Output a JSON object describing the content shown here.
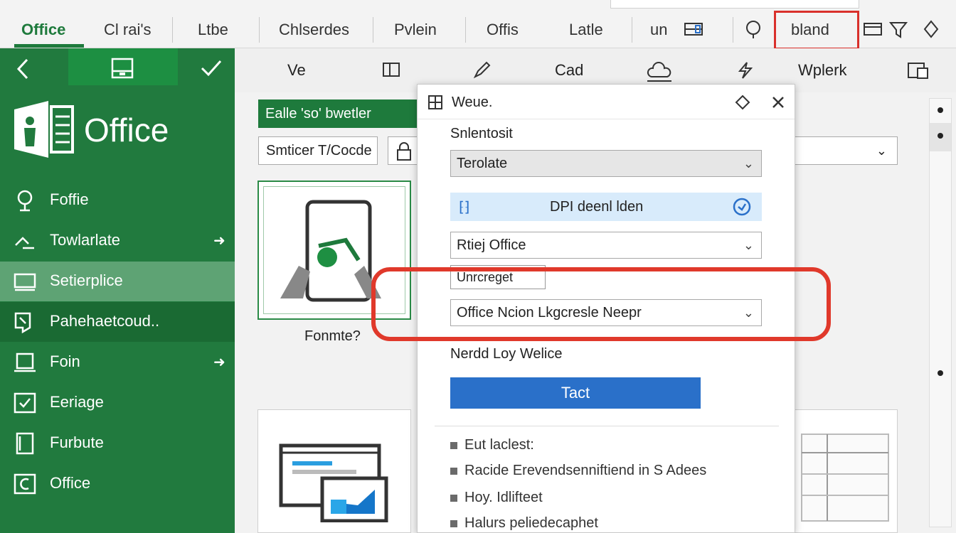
{
  "top_tabs": [
    "Office",
    "Cl rai's",
    "Ltbe",
    "Chlserdes",
    "Pvlein",
    "Offis",
    "Latle",
    "un"
  ],
  "highlighted_tab": "bland",
  "sidebar": {
    "brand": "Office",
    "items": [
      {
        "label": "Foffie",
        "arrow": false
      },
      {
        "label": "Towlarlate",
        "arrow": true
      },
      {
        "label": "Setierplice",
        "arrow": false
      },
      {
        "label": "Pahehaetcoud..",
        "arrow": false
      },
      {
        "label": "Foin",
        "arrow": true
      },
      {
        "label": "Eeriage",
        "arrow": false
      },
      {
        "label": "Furbute",
        "arrow": false
      },
      {
        "label": "Office",
        "arrow": false
      }
    ]
  },
  "toolbar2": {
    "ve": "Ve",
    "cad": "Cad",
    "wplerk": "Wplerk"
  },
  "content": {
    "green_button": "Ealle 'so' bwetler",
    "search_field": "Smticer T/Cocde",
    "card_caption": "Fonmte?"
  },
  "dialog": {
    "title": "Weue.",
    "section_label": "Snlentosit",
    "select1": "Terolate",
    "info_bar": "DPI deenl lden",
    "select2": "Rtiej Office",
    "small_label": "Unrcreget",
    "select3": "Office Ncion Lkgcresle Neepr",
    "section2": "Nerdd Loy Welice",
    "button": "Tact",
    "bullets": [
      "Eut laclest:",
      "Racide Erevendsenniftiend in S Adees",
      "Hoy. Idlifteet",
      "Halurs peliedecaphet"
    ]
  }
}
